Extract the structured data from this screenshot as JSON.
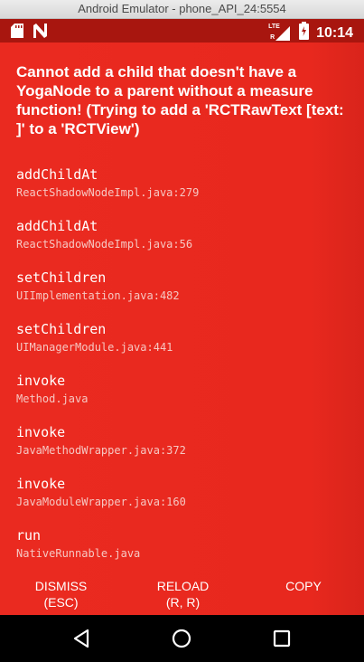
{
  "window": {
    "title": "Android Emulator - phone_API_24:5554"
  },
  "status_bar": {
    "time": "10:14",
    "network": "LTE",
    "network_sub": "R"
  },
  "error": {
    "message": "Cannot add a child that doesn't have a YogaNode to a parent without a measure function! (Trying to add a 'RCTRawText [text:   ]' to a 'RCTView')",
    "stack": [
      {
        "method": "addChildAt",
        "file": "ReactShadowNodeImpl.java:279"
      },
      {
        "method": "addChildAt",
        "file": "ReactShadowNodeImpl.java:56"
      },
      {
        "method": "setChildren",
        "file": "UIImplementation.java:482"
      },
      {
        "method": "setChildren",
        "file": "UIManagerModule.java:441"
      },
      {
        "method": "invoke",
        "file": "Method.java"
      },
      {
        "method": "invoke",
        "file": "JavaMethodWrapper.java:372"
      },
      {
        "method": "invoke",
        "file": "JavaModuleWrapper.java:160"
      },
      {
        "method": "run",
        "file": "NativeRunnable.java"
      }
    ]
  },
  "buttons": {
    "dismiss_label": "DISMISS",
    "dismiss_shortcut": "(ESC)",
    "reload_label": "RELOAD",
    "reload_shortcut": "(R, R)",
    "copy_label": "COPY"
  },
  "icons": {
    "status_left": [
      "sd-card-icon",
      "n-notification-icon"
    ],
    "status_right": [
      "lte-signal-icon",
      "battery-charging-icon"
    ],
    "nav": [
      "back-icon",
      "home-icon",
      "recents-icon"
    ]
  },
  "colors": {
    "redbox_background": "#e8281e",
    "status_bar": "#a8160f",
    "nav_bar": "#000000"
  }
}
